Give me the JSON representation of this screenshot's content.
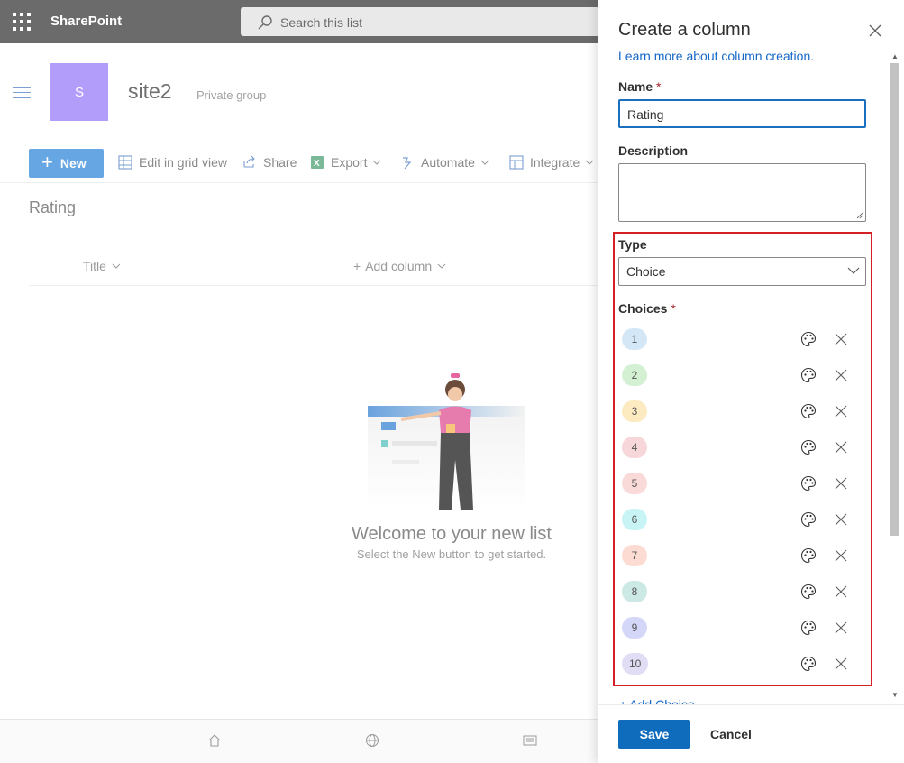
{
  "suite": {
    "app_name": "SharePoint",
    "search_placeholder": "Search this list"
  },
  "site": {
    "logo_letter": "S",
    "name": "site2",
    "type": "Private group"
  },
  "commands": {
    "new": "New",
    "edit_grid": "Edit in grid view",
    "share": "Share",
    "export": "Export",
    "automate": "Automate",
    "integrate": "Integrate"
  },
  "list": {
    "title": "Rating",
    "columns": {
      "title": "Title",
      "add_column": "Add column"
    },
    "empty_title": "Welcome to your new list",
    "empty_sub": "Select the New button to get started."
  },
  "panel": {
    "title": "Create a column",
    "learn_more": "Learn more about column creation.",
    "name_label": "Name",
    "name_value": "Rating",
    "required_mark": "*",
    "description_label": "Description",
    "description_value": "",
    "type_label": "Type",
    "type_value": "Choice",
    "choices_label": "Choices",
    "choices": [
      {
        "label": "1",
        "color": "#d4e7f7"
      },
      {
        "label": "2",
        "color": "#d3f0d2"
      },
      {
        "label": "3",
        "color": "#fcebc0"
      },
      {
        "label": "4",
        "color": "#f8d7da"
      },
      {
        "label": "5",
        "color": "#fad9d9"
      },
      {
        "label": "6",
        "color": "#c9f4f6"
      },
      {
        "label": "7",
        "color": "#fcdcd2"
      },
      {
        "label": "8",
        "color": "#cde9e5"
      },
      {
        "label": "9",
        "color": "#d4d7f7"
      },
      {
        "label": "10",
        "color": "#e0ddf4"
      }
    ],
    "add_choice": "Add Choice",
    "save": "Save",
    "cancel": "Cancel"
  },
  "colors": {
    "accent": "#0f6cbd",
    "highlight": "#d62028",
    "site_logo": "#b39dfb"
  }
}
